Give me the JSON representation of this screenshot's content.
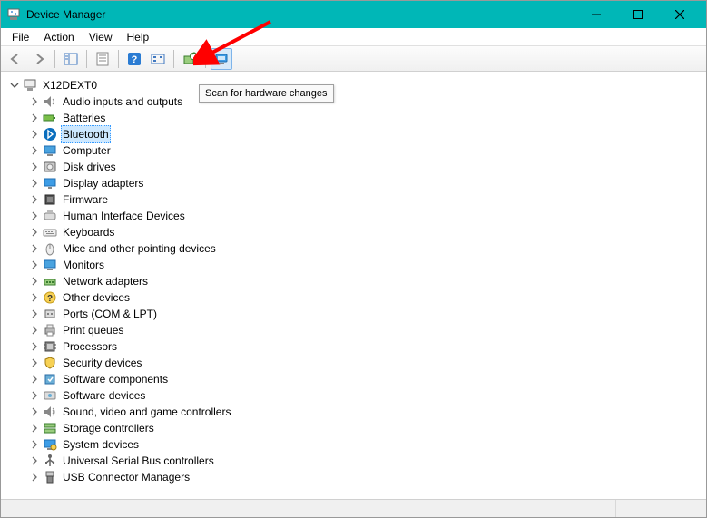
{
  "window": {
    "title": "Device Manager"
  },
  "menu": {
    "file": "File",
    "action": "Action",
    "view": "View",
    "help": "Help"
  },
  "toolbar": {
    "back": "back-icon",
    "forward": "forward-icon",
    "show_hide": "show-hide-tree-icon",
    "properties": "properties-icon",
    "help": "help-icon",
    "update": "update-driver-icon",
    "uninstall": "uninstall-icon",
    "scan": "scan-hardware-icon"
  },
  "tooltip": {
    "text": "Scan for hardware changes"
  },
  "tree": {
    "root": {
      "label": "X12DEXT0",
      "icon": "computer-root-icon",
      "expanded": true
    },
    "items": [
      {
        "label": "Audio inputs and outputs",
        "icon": "audio-icon"
      },
      {
        "label": "Batteries",
        "icon": "battery-icon"
      },
      {
        "label": "Bluetooth",
        "icon": "bluetooth-icon",
        "selected": true
      },
      {
        "label": "Computer",
        "icon": "computer-icon"
      },
      {
        "label": "Disk drives",
        "icon": "disk-icon"
      },
      {
        "label": "Display adapters",
        "icon": "display-icon"
      },
      {
        "label": "Firmware",
        "icon": "firmware-icon"
      },
      {
        "label": "Human Interface Devices",
        "icon": "hid-icon"
      },
      {
        "label": "Keyboards",
        "icon": "keyboard-icon"
      },
      {
        "label": "Mice and other pointing devices",
        "icon": "mouse-icon"
      },
      {
        "label": "Monitors",
        "icon": "monitor-icon"
      },
      {
        "label": "Network adapters",
        "icon": "network-icon"
      },
      {
        "label": "Other devices",
        "icon": "other-icon"
      },
      {
        "label": "Ports (COM & LPT)",
        "icon": "port-icon"
      },
      {
        "label": "Print queues",
        "icon": "printer-icon"
      },
      {
        "label": "Processors",
        "icon": "cpu-icon"
      },
      {
        "label": "Security devices",
        "icon": "security-icon"
      },
      {
        "label": "Software components",
        "icon": "software-component-icon"
      },
      {
        "label": "Software devices",
        "icon": "software-device-icon"
      },
      {
        "label": "Sound, video and game controllers",
        "icon": "sound-icon"
      },
      {
        "label": "Storage controllers",
        "icon": "storage-icon"
      },
      {
        "label": "System devices",
        "icon": "system-icon"
      },
      {
        "label": "Universal Serial Bus controllers",
        "icon": "usb-icon"
      },
      {
        "label": "USB Connector Managers",
        "icon": "usb-connector-icon"
      }
    ]
  }
}
